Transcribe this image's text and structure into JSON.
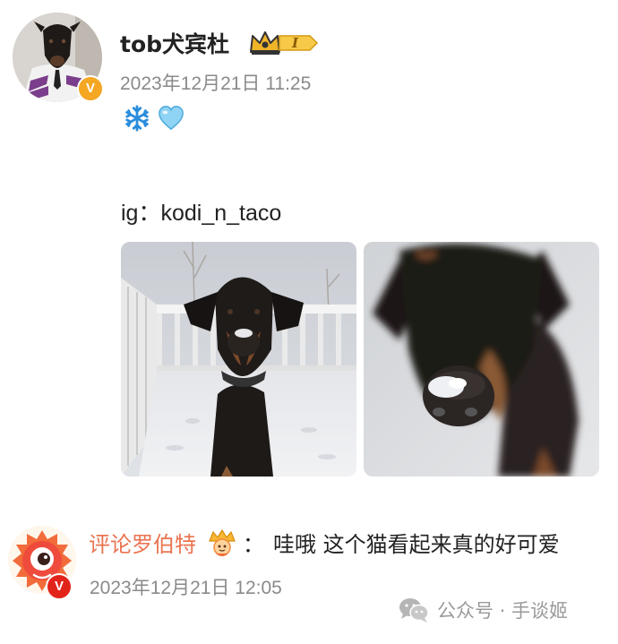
{
  "post": {
    "username": "tob犬宾杜",
    "timestamp": "2023年12月21日 11:25",
    "emojis": [
      "snowflake-emoji",
      "light-blue-heart-emoji"
    ],
    "caption": "ig：kodi_n_taco",
    "images": [
      {
        "name": "doberman-on-snowy-deck-photo"
      },
      {
        "name": "doberman-snowy-nose-closeup-photo"
      }
    ],
    "badges": {
      "vip_level": "I",
      "verified_color": "#f5a623"
    }
  },
  "comment": {
    "author": "评论罗伯特",
    "separator": "：",
    "text": "哇哦 这个猫看起来真的好可爱",
    "timestamp": "2023年12月21日 12:05",
    "verified_color": "#e2231a",
    "author_color": "#eb7350"
  },
  "watermark": {
    "text": "公众号 · 手谈姬"
  },
  "colors": {
    "meta_text": "#8a8a8a",
    "body_text": "#222222",
    "background": "#ffffff"
  }
}
